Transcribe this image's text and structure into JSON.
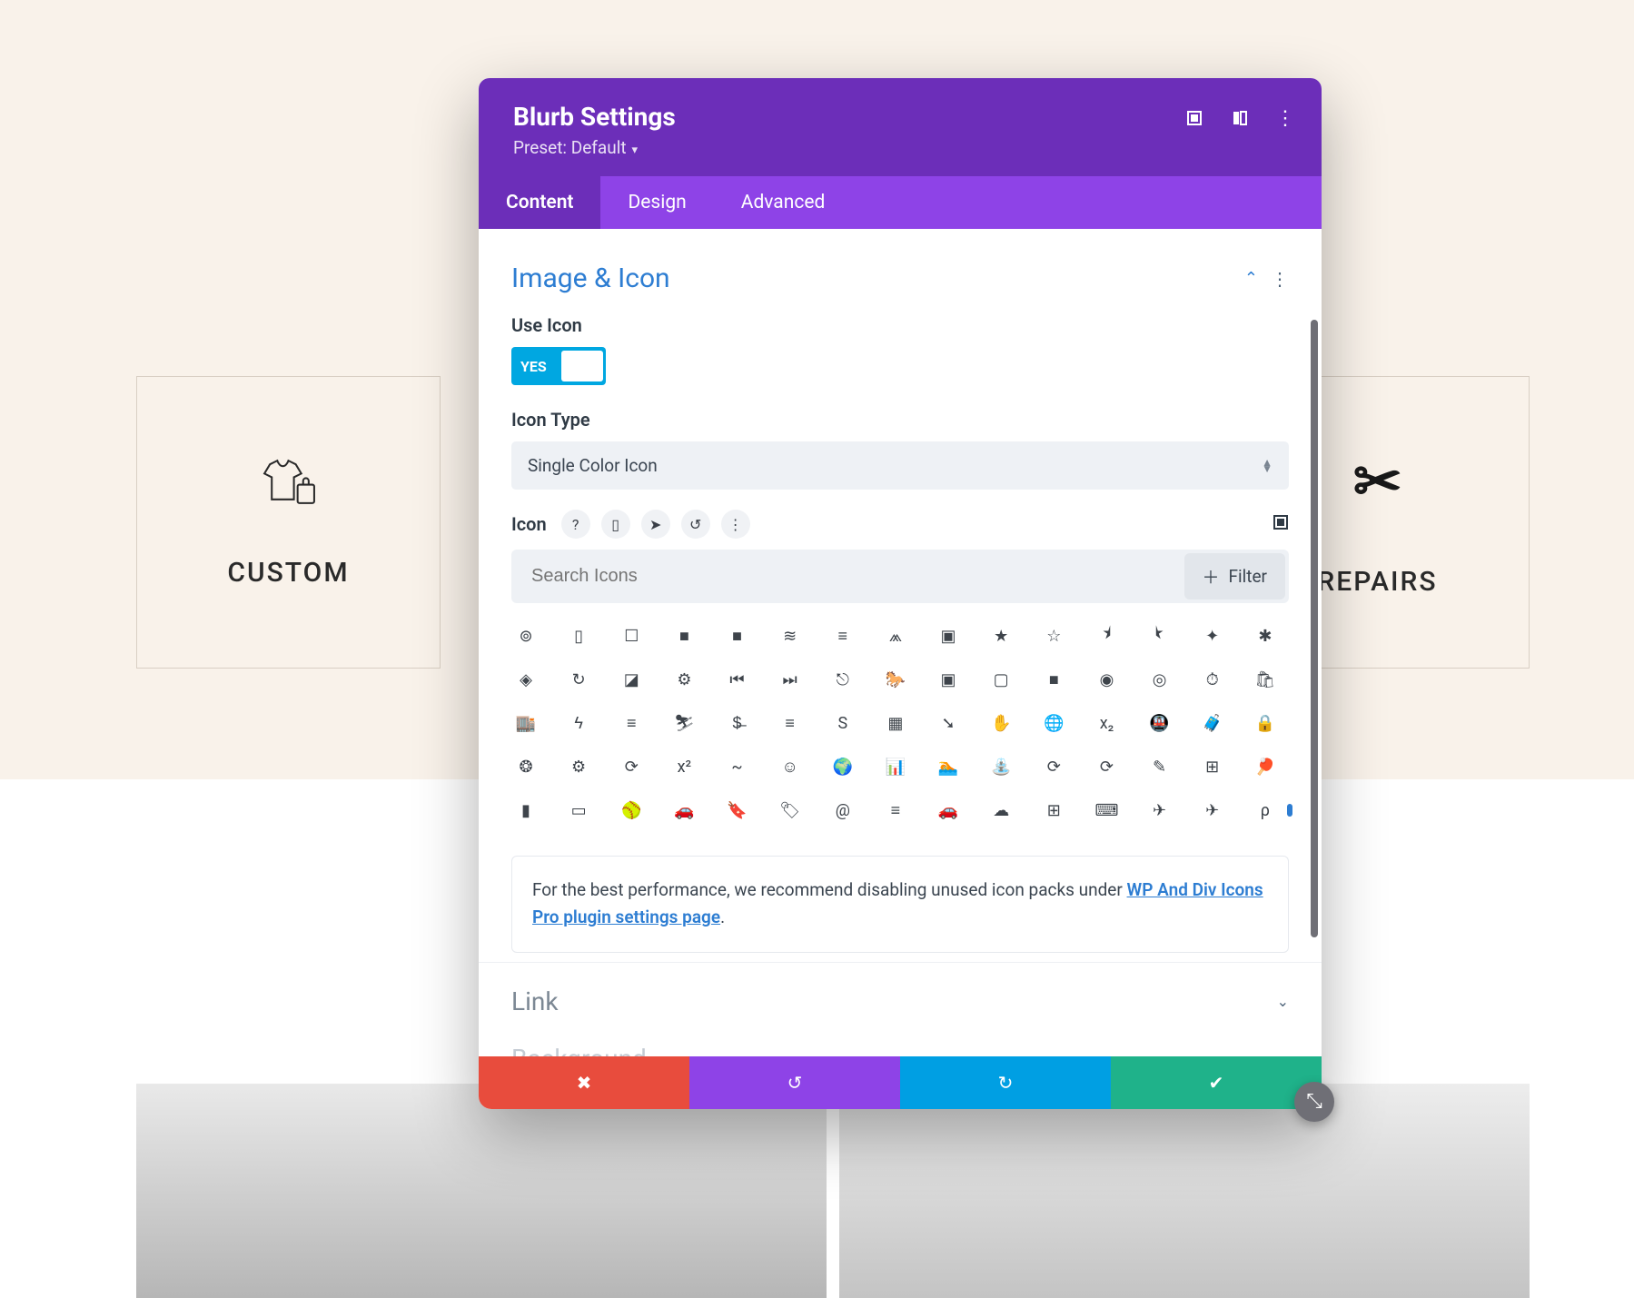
{
  "background_cards": {
    "left_label": "CUSTOM",
    "right_label": "REPAIRS"
  },
  "modal": {
    "title": "Blurb Settings",
    "preset": "Preset: Default",
    "header_icons": [
      "expand-icon",
      "sidebar-toggle-icon",
      "more-icon"
    ],
    "tabs": [
      {
        "label": "Content",
        "active": true
      },
      {
        "label": "Design",
        "active": false
      },
      {
        "label": "Advanced",
        "active": false
      }
    ]
  },
  "section": {
    "title": "Image & Icon",
    "use_icon": {
      "label": "Use Icon",
      "value": "YES"
    },
    "icon_type": {
      "label": "Icon Type",
      "selected": "Single Color Icon"
    },
    "icon_row": {
      "label": "Icon",
      "pills": [
        "help-icon",
        "mobile-icon",
        "cursor-icon",
        "undo-icon",
        "more-icon"
      ]
    },
    "search": {
      "placeholder": "Search Icons"
    },
    "filter_label": "Filter",
    "icon_grid": [
      "⊚",
      "▯",
      "☐",
      "■",
      "■",
      "≋",
      "≡",
      "⩕",
      "▣",
      "★",
      "☆",
      "⯨",
      "⯩",
      "✦",
      "✱",
      "◈",
      "↻",
      "◪",
      "⚙",
      "⏮",
      "⏭",
      "⎋",
      "🐎",
      "▣",
      "▢",
      "■",
      "◉",
      "◎",
      "⏱",
      "🛍",
      "🏬",
      "ϟ",
      "≡",
      "⛷",
      "$̶",
      "≡",
      "S",
      "▦",
      "➘",
      "✋",
      "🌐",
      "x₂",
      "🚇",
      "🧳",
      "🔒",
      "❂",
      "⚙",
      "⟳",
      "x²",
      "~",
      "☺",
      "🌍",
      "📊",
      "🏊",
      "⛲",
      "⟳",
      "⟳",
      "✎",
      "⊞",
      "🏓",
      "▮",
      "▭",
      "🥎",
      "🚗",
      "🔖",
      "🏷",
      "@",
      "≡",
      "🚗",
      "☁",
      "⊞",
      "⌨",
      "✈",
      "✈",
      "ρ"
    ],
    "note_prefix": "For the best performance, we recommend disabling unused icon packs under ",
    "note_link": "WP And Div Icons Pro plugin settings page",
    "note_suffix": "."
  },
  "collapsed_sections": {
    "link": "Link",
    "background": "Background"
  },
  "footer_icons": [
    "✖",
    "↺",
    "↻",
    "✔"
  ]
}
